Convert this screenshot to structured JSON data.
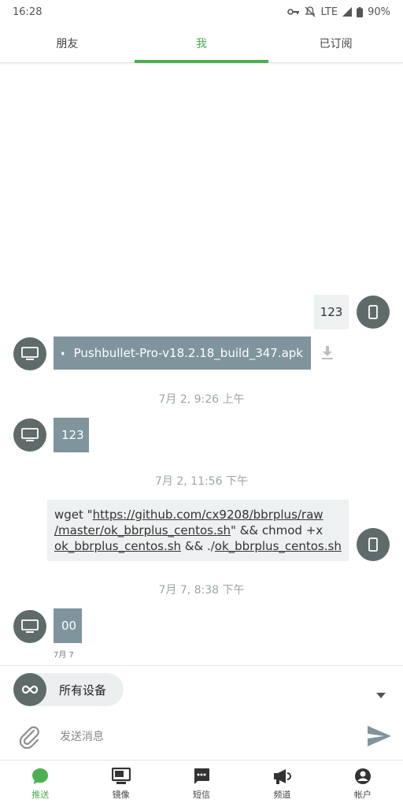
{
  "status_bar": {
    "time": "16:28",
    "network": "LTE",
    "battery": "90%"
  },
  "tabs": [
    {
      "label": "朋友",
      "active": false
    },
    {
      "label": "我",
      "active": true
    },
    {
      "label": "已订阅",
      "active": false
    }
  ],
  "messages": {
    "m1": {
      "text": "123",
      "from": "phone"
    },
    "m2": {
      "file_name": "Pushbullet-Pro-v18.2.18_build_347.apk",
      "from": "computer"
    },
    "ts1": "7月 2, 9:26 上午",
    "m3": {
      "text": "123",
      "from": "computer"
    },
    "ts2": "7月 2, 11:56 下午",
    "m4": {
      "part1": "wget \"",
      "link1a": "https://github.com/cx9208/bbrplus/raw",
      "link1b": "/master/ok_bbrplus_centos.sh",
      "part2": "\" && chmod +x",
      "link2": "ok_bbrplus_centos.sh",
      "part3": " && ./",
      "link3": "ok_bbrplus_centos.sh",
      "from": "phone"
    },
    "ts3": "7月 7, 8:38 下午",
    "m5": {
      "text": "00",
      "from": "computer",
      "date": "7月 7"
    }
  },
  "device_selector": {
    "label": "所有设备"
  },
  "composer": {
    "placeholder": "发送消息"
  },
  "bottom_nav": [
    {
      "label": "推送",
      "icon": "chat-bubble-icon",
      "active": true
    },
    {
      "label": "镜像",
      "icon": "mirror-screen-icon",
      "active": false
    },
    {
      "label": "短信",
      "icon": "sms-icon",
      "active": false
    },
    {
      "label": "频道",
      "icon": "megaphone-icon",
      "active": false
    },
    {
      "label": "帐户",
      "icon": "account-icon",
      "active": false
    }
  ],
  "colors": {
    "accent": "#4caf50",
    "avatar": "#5f6a6a",
    "dark_bubble": "#7f949c",
    "light_bubble": "#edf1f2",
    "timestamp": "#9aa6a8"
  }
}
